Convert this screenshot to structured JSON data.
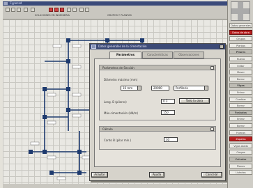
{
  "app": {
    "title": "Cypecad",
    "toolbar_info": [
      "SOLUCIONES EN INGENIERIA",
      "GRUPOS Y PLANTAS"
    ]
  },
  "statusbar": {
    "text": ""
  },
  "right_dock": {
    "items": [
      {
        "label": "Datos generales",
        "style": "normal"
      },
      {
        "label": "Datos de obra",
        "style": "sel"
      },
      {
        "label": "Grupos",
        "style": "normal"
      },
      {
        "label": "Plantas",
        "style": "normal"
      },
      {
        "label": "Pilares",
        "style": "head"
      },
      {
        "label": "Nuevo",
        "style": "normal"
      },
      {
        "label": "Editar",
        "style": "normal"
      },
      {
        "label": "Mover",
        "style": "normal"
      },
      {
        "label": "Borrar",
        "style": "normal"
      },
      {
        "label": "Vigas",
        "style": "head"
      },
      {
        "label": "Entrar",
        "style": "normal"
      },
      {
        "label": "Cambiar",
        "style": "normal"
      },
      {
        "label": "Borrar",
        "style": "normal"
      },
      {
        "label": "Forjados",
        "style": "head"
      },
      {
        "label": "Entrar",
        "style": "normal"
      },
      {
        "label": "Borrar",
        "style": "normal"
      },
      {
        "label": "Huecos",
        "style": "normal"
      },
      {
        "label": "Zapatas",
        "style": "sel"
      },
      {
        "label": "Vigas atado",
        "style": "normal"
      },
      {
        "label": "Cargas",
        "style": "normal"
      },
      {
        "label": "Calcular",
        "style": "head"
      },
      {
        "label": "Planos",
        "style": "normal"
      },
      {
        "label": "Listados",
        "style": "normal"
      }
    ]
  },
  "dialog": {
    "title": "Datos generales de la cimentación",
    "tabs": [
      "Parámetros",
      "Características",
      "Observaciones"
    ],
    "group1": {
      "title": "Parámetros de Sección",
      "diameter_label": "Diámetro máximo (mm)",
      "diameter_value": "16 mm",
      "spacing_value": "20000",
      "finish_value": "Perfilería",
      "long_label": "Long. B (pilares)",
      "long_value": "0.3",
      "apply_button": "Todo la obra",
      "max_label": "Máx.cimentación (kN/m)",
      "max_value": "150"
    },
    "group2": {
      "title": "Cálculo",
      "depth_label": "Canto B (pilar mín.)",
      "depth_value": "30"
    },
    "buttons": {
      "accept": "Aceptar",
      "help": "Ayuda",
      "cancel": "Cancelar"
    }
  }
}
